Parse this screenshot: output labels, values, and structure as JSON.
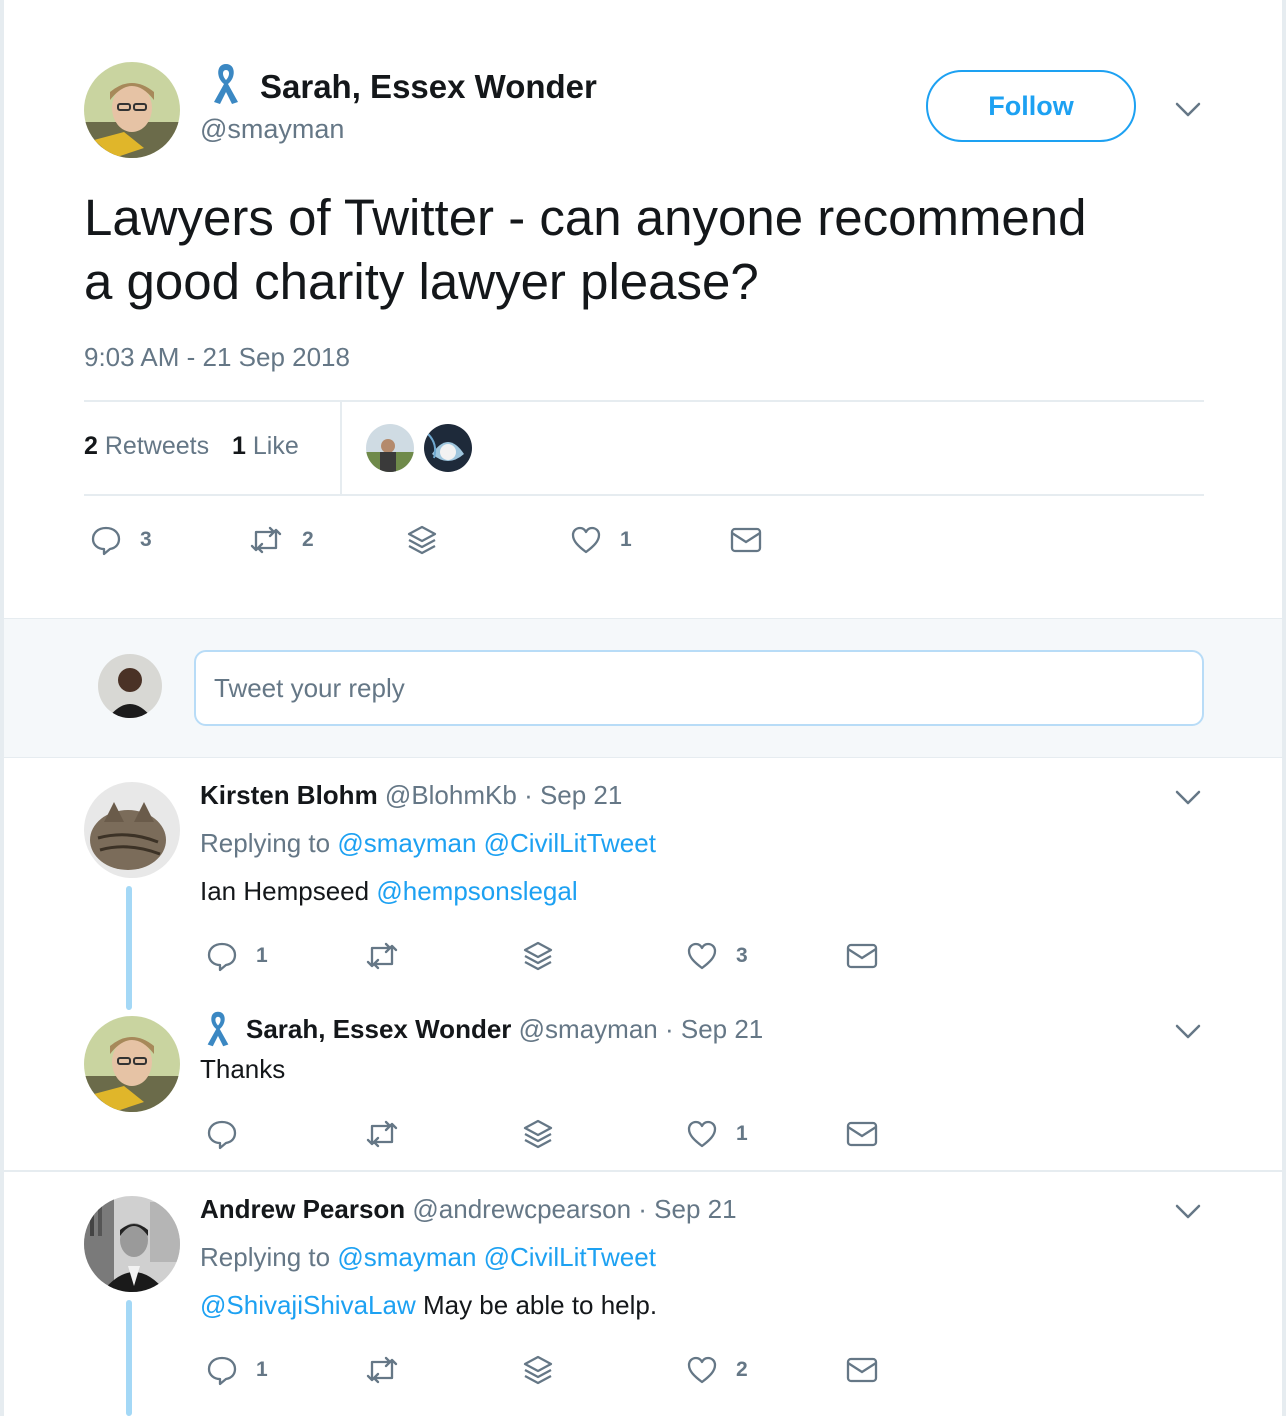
{
  "main_tweet": {
    "author_name": "Sarah, Essex Wonder",
    "author_handle": "@smayman",
    "follow_label": "Follow",
    "text_line1": "Lawyers of Twitter - can anyone recommend",
    "text_line2": "a good charity lawyer please?",
    "timestamp": "9:03 AM - 21 Sep 2018",
    "retweets_count": "2",
    "retweets_label": "Retweets",
    "likes_count": "1",
    "likes_label": "Like",
    "actions": {
      "replies": "3",
      "retweets": "2",
      "likes": "1"
    }
  },
  "reply_box": {
    "placeholder": "Tweet your reply"
  },
  "replies": [
    {
      "name": "Kirsten Blohm",
      "handle": "@BlohmKb",
      "date": "· Sep 21",
      "replying_prefix": "Replying to",
      "replying_to": "@smayman @CivilLitTweet",
      "text_plain": "Ian Hempseed",
      "text_mention": "@hempsonslegal",
      "actions": {
        "replies": "1",
        "retweets": "",
        "likes": "3"
      }
    },
    {
      "name": "Sarah, Essex Wonder",
      "handle": "@smayman",
      "date": "· Sep 21",
      "text_plain": "Thanks",
      "actions": {
        "replies": "",
        "retweets": "",
        "likes": "1"
      }
    },
    {
      "name": "Andrew Pearson",
      "handle": "@andrewcpearson",
      "date": "· Sep 21",
      "replying_prefix": "Replying to",
      "replying_to": "@smayman @CivilLitTweet",
      "text_mention": "@ShivajiShivaLaw",
      "text_plain": "May be able to help.",
      "actions": {
        "replies": "1",
        "retweets": "",
        "likes": "2"
      }
    }
  ],
  "colors": {
    "accent": "#1da1f2",
    "secondary_text": "#657786",
    "thread_line": "#a4d8f6",
    "ribbon": "#3b88c3"
  }
}
